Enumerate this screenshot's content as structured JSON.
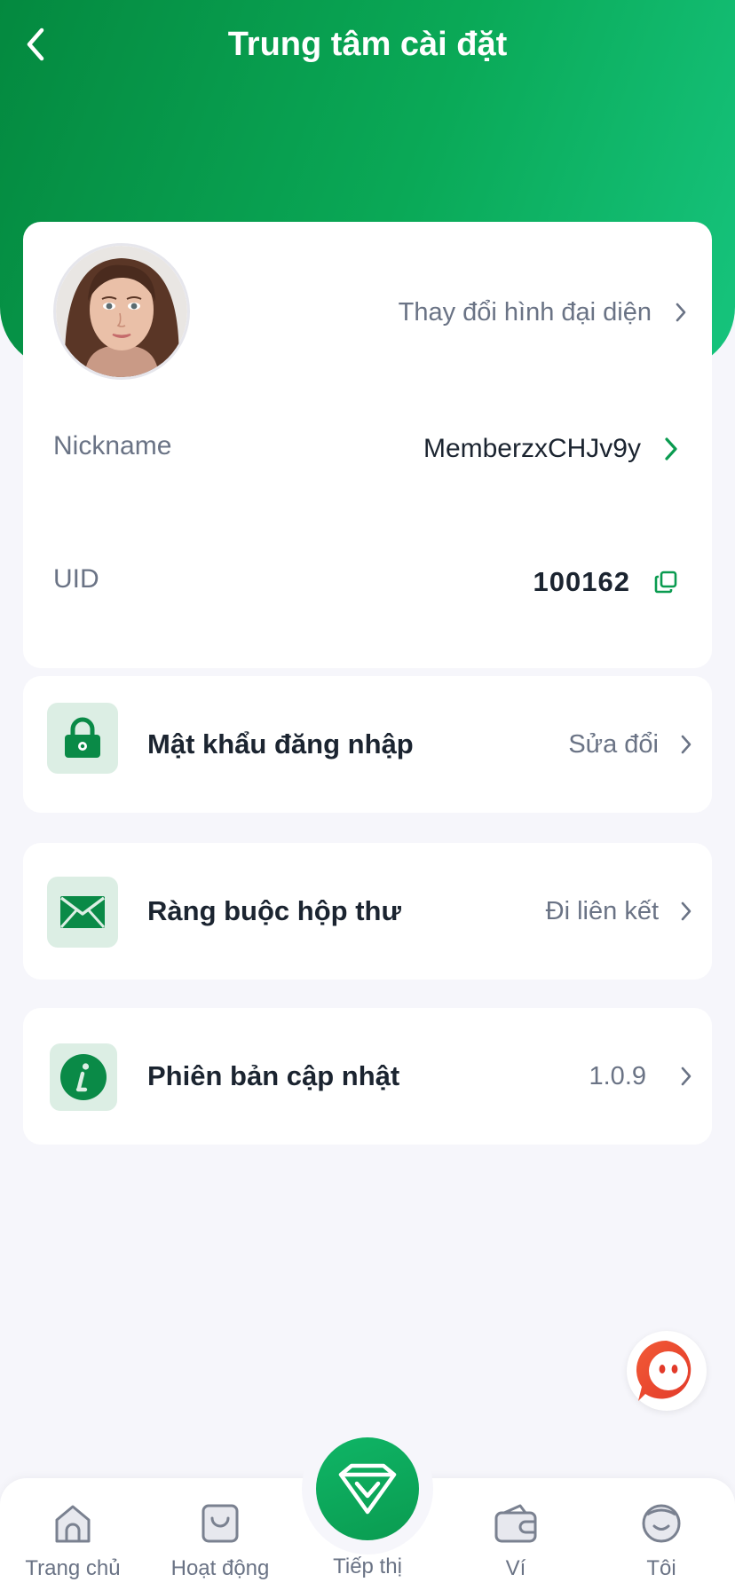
{
  "header": {
    "title": "Trung tâm cài đặt"
  },
  "profile": {
    "change_avatar_label": "Thay đổi hình đại diện",
    "nickname_label": "Nickname",
    "nickname_value": "MemberzxCHJv9y",
    "uid_label": "UID",
    "uid_value": "100162"
  },
  "settings": [
    {
      "title": "Mật khẩu đăng nhập",
      "action": "Sửa đổi",
      "icon": "lock-icon"
    },
    {
      "title": "Ràng buộc hộp thư",
      "action": "Đi liên kết",
      "icon": "mail-icon"
    },
    {
      "title": "Phiên bản cập nhật",
      "action": "1.0.9",
      "icon": "info-icon"
    }
  ],
  "tabbar": {
    "home": "Trang chủ",
    "activity": "Hoạt động",
    "marketing": "Tiếp thị",
    "wallet": "Ví",
    "me": "Tôi"
  },
  "colors": {
    "brand_green": "#0a9b50",
    "header_gradient_start": "#04893f",
    "header_gradient_end": "#16c47d",
    "icon_bg": "#dceee4",
    "muted_text": "#6a7385",
    "chat_red": "#f04a2f"
  }
}
